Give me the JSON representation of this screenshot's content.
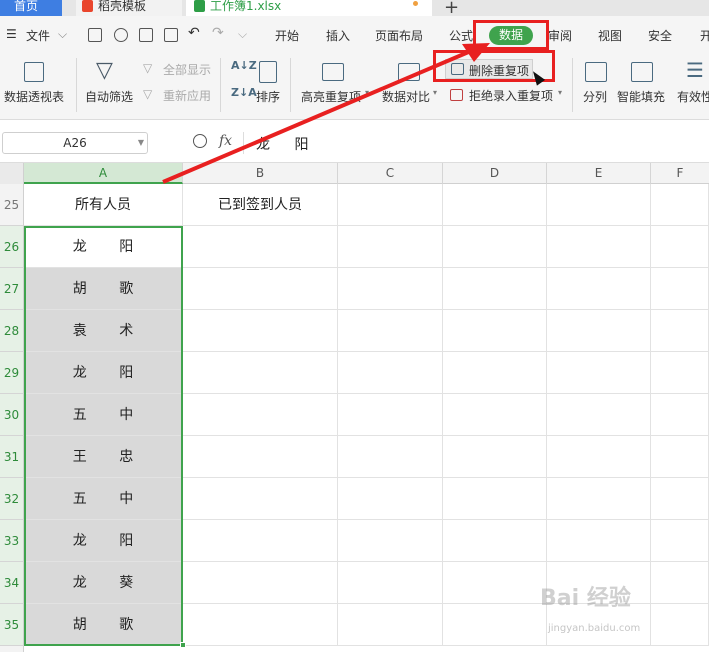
{
  "tabs": {
    "home": "首页",
    "template": "稻壳模板",
    "workbook": "工作簿1.xlsx",
    "new_tab": "+"
  },
  "menu": {
    "file": "文件",
    "items": [
      "开始",
      "插入",
      "页面布局",
      "公式",
      "数据",
      "审阅",
      "视图",
      "安全",
      "开"
    ]
  },
  "ribbon": {
    "pivot": "数据透视表",
    "autofilter": "自动筛选",
    "show_all": "全部显示",
    "reapply": "重新应用",
    "sort": "排序",
    "highlight_dup": "高亮重复项",
    "data_compare": "数据对比",
    "remove_dup": "删除重复项",
    "reject_dup": "拒绝录入重复项",
    "split": "分列",
    "smart_fill": "智能填充",
    "validity": "有效性"
  },
  "formula_bar": {
    "name_box": "A26",
    "fx": "fx",
    "value": "龙 阳"
  },
  "grid": {
    "columns": [
      "A",
      "B",
      "C",
      "D",
      "E",
      "F"
    ],
    "rows": [
      {
        "num": "25",
        "a": "所有人员",
        "b": "已到签到人员"
      },
      {
        "num": "26",
        "a": "龙 阳",
        "b": ""
      },
      {
        "num": "27",
        "a": "胡 歌",
        "b": ""
      },
      {
        "num": "28",
        "a": "袁 术",
        "b": ""
      },
      {
        "num": "29",
        "a": "龙 阳",
        "b": ""
      },
      {
        "num": "30",
        "a": "五 中",
        "b": ""
      },
      {
        "num": "31",
        "a": "王 忠",
        "b": ""
      },
      {
        "num": "32",
        "a": "五 中",
        "b": ""
      },
      {
        "num": "33",
        "a": "龙 阳",
        "b": ""
      },
      {
        "num": "34",
        "a": "龙 葵",
        "b": ""
      },
      {
        "num": "35",
        "a": "胡 歌",
        "b": ""
      }
    ]
  },
  "watermark": {
    "main": "Bai 经验",
    "sub": "jingyan.baidu.com"
  },
  "colors": {
    "accent_green": "#3fa34d",
    "annotation_red": "#e82020",
    "home_tab_blue": "#3e7ee2"
  }
}
